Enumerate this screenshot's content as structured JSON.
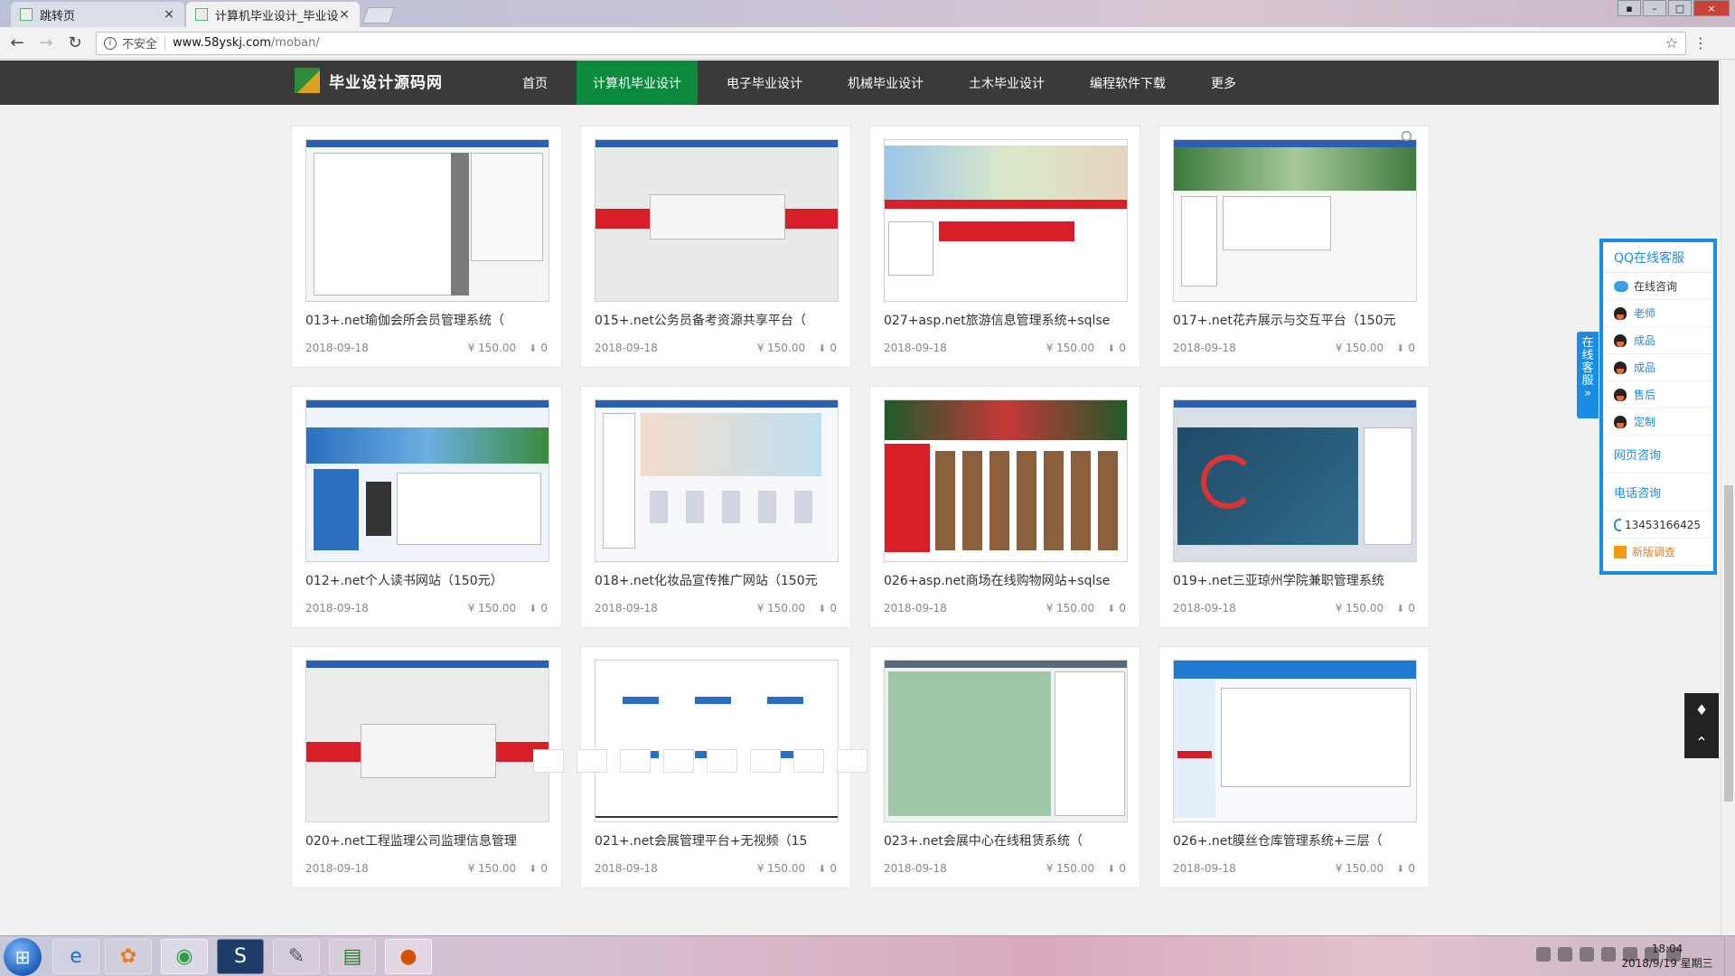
{
  "browser": {
    "tabs": [
      {
        "title": "跳转页",
        "active": false
      },
      {
        "title": "计算机毕业设计_毕业设计",
        "active": true
      }
    ],
    "address": {
      "security_label": "不安全",
      "domain": "www.58yskj.com",
      "path": "/moban/"
    }
  },
  "site": {
    "logo_text": "毕业设计源码网",
    "nav": [
      {
        "label": "首页",
        "active": false
      },
      {
        "label": "计算机毕业设计",
        "active": true
      },
      {
        "label": "电子毕业设计",
        "active": false
      },
      {
        "label": "机械毕业设计",
        "active": false
      },
      {
        "label": "土木毕业设计",
        "active": false
      },
      {
        "label": "编程软件下载",
        "active": false
      },
      {
        "label": "更多",
        "active": false
      }
    ]
  },
  "cards": [
    {
      "title": "013+.net瑜伽会所会员管理系统（",
      "date": "2018-09-18",
      "price": "¥ 150.00",
      "downloads": "0",
      "thumb": "ide"
    },
    {
      "title": "015+.net公务员备考资源共享平台（",
      "date": "2018-09-18",
      "price": "¥ 150.00",
      "downloads": "0",
      "thumb": "login-red"
    },
    {
      "title": "027+asp.net旅游信息管理系统+sqlse",
      "date": "2018-09-18",
      "price": "¥ 150.00",
      "downloads": "0",
      "thumb": "travel"
    },
    {
      "title": "017+.net花卉展示与交互平台（150元",
      "date": "2018-09-18",
      "price": "¥ 150.00",
      "downloads": "0",
      "thumb": "flower"
    },
    {
      "title": "012+.net个人读书网站（150元）",
      "date": "2018-09-18",
      "price": "¥ 150.00",
      "downloads": "0",
      "thumb": "reading"
    },
    {
      "title": "018+.net化妆品宣传推广网站（150元",
      "date": "2018-09-18",
      "price": "¥ 150.00",
      "downloads": "0",
      "thumb": "cosmetic"
    },
    {
      "title": "026+asp.net商场在线购物网站+sqlse",
      "date": "2018-09-18",
      "price": "¥ 150.00",
      "downloads": "0",
      "thumb": "shop"
    },
    {
      "title": "019+.net三亚琼州学院兼职管理系统",
      "date": "2018-09-18",
      "price": "¥ 150.00",
      "downloads": "0",
      "thumb": "parttime"
    },
    {
      "title": "020+.net工程监理公司监理信息管理",
      "date": "2018-09-18",
      "price": "¥ 150.00",
      "downloads": "0",
      "thumb": "login-red2"
    },
    {
      "title": "021+.net会展管理平台+无视频（15",
      "date": "2018-09-18",
      "price": "¥ 150.00",
      "downloads": "0",
      "thumb": "diagram"
    },
    {
      "title": "023+.net会展中心在线租赁系统（",
      "date": "2018-09-18",
      "price": "¥ 150.00",
      "downloads": "0",
      "thumb": "designer"
    },
    {
      "title": "026+.net膜丝仓库管理系统+三层（",
      "date": "2018-09-18",
      "price": "¥ 150.00",
      "downloads": "0",
      "thumb": "admin"
    }
  ],
  "qq_panel": {
    "title": "QQ在线客服",
    "side_tab": [
      "在",
      "线",
      "客",
      "服",
      "»"
    ],
    "items": [
      {
        "label": "在线咨询",
        "icon": "qq-cloud-icon",
        "style": "dark"
      },
      {
        "label": "老师",
        "icon": "qq-penguin-icon",
        "style": "link"
      },
      {
        "label": "成品",
        "icon": "qq-penguin-icon",
        "style": "link"
      },
      {
        "label": "成品",
        "icon": "qq-penguin-icon",
        "style": "link"
      },
      {
        "label": "售后",
        "icon": "qq-penguin-icon",
        "style": "link"
      }
    ],
    "custom_label": "定制",
    "web_consult": "网页咨询",
    "phone_title": "电话咨询",
    "phone_number": "13453166425",
    "survey": "新版调查"
  },
  "taskbar": {
    "time": "18:04",
    "date": "2018/9/19 星期三"
  },
  "colors": {
    "nav_active": "#0b8a3e",
    "qq_blue": "#1a8ce6"
  }
}
